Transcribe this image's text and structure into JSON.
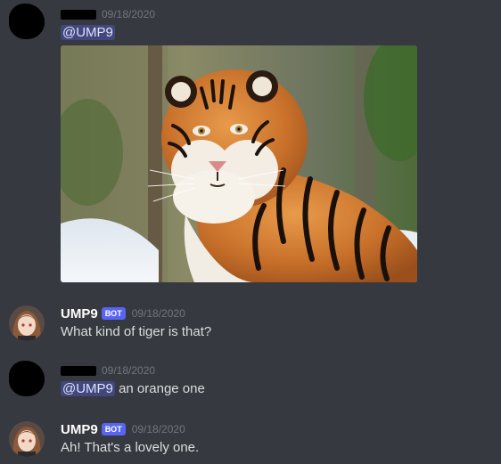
{
  "messages": [
    {
      "author": "",
      "author_redacted": true,
      "bot": false,
      "timestamp": "09/18/2020",
      "mention": "@UMP9",
      "text": "",
      "attachment": "tiger-photo"
    },
    {
      "author": "UMP9",
      "author_redacted": false,
      "bot": true,
      "bot_label": "BOT",
      "timestamp": "09/18/2020",
      "text": "What kind of tiger is that?"
    },
    {
      "author": "",
      "author_redacted": true,
      "bot": false,
      "timestamp": "09/18/2020",
      "mention": "@UMP9",
      "text": " an orange one"
    },
    {
      "author": "UMP9",
      "author_redacted": false,
      "bot": true,
      "bot_label": "BOT",
      "timestamp": "09/18/2020",
      "text": "Ah! That's a lovely one."
    }
  ],
  "colors": {
    "background": "#36393f",
    "username": "#ffffff",
    "text": "#dcddde",
    "timestamp": "#72767d",
    "bot_badge": "#5865f2",
    "mention_bg": "#4a4f87"
  }
}
